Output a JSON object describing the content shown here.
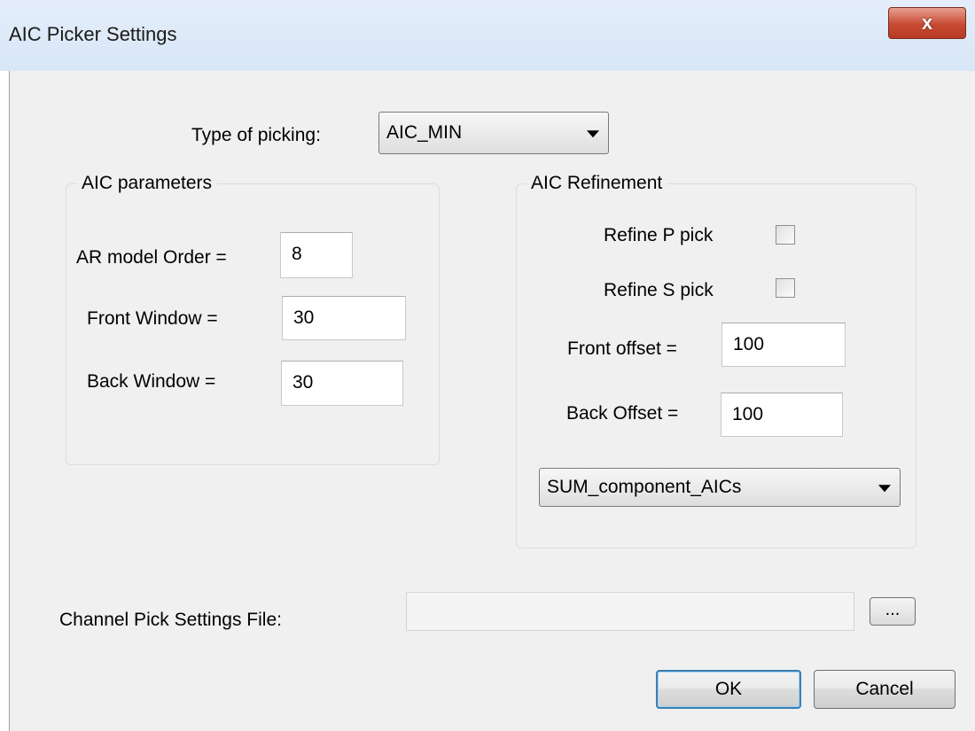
{
  "window": {
    "title": "AIC Picker Settings",
    "close_glyph": "x"
  },
  "picking": {
    "label": "Type of picking:",
    "selected": "AIC_MIN"
  },
  "aic_parameters": {
    "title": "AIC parameters",
    "ar_order_label": "AR model Order =",
    "ar_order_value": "8",
    "front_window_label": "Front Window =",
    "front_window_value": "30",
    "back_window_label": "Back Window =",
    "back_window_value": "30"
  },
  "aic_refinement": {
    "title": "AIC Refinement",
    "refine_p_label": "Refine P pick",
    "refine_p_checked": false,
    "refine_s_label": "Refine S pick",
    "refine_s_checked": false,
    "front_offset_label": "Front offset =",
    "front_offset_value": "100",
    "back_offset_label": "Back Offset =",
    "back_offset_value": "100",
    "method_selected": "SUM_component_AICs"
  },
  "channel_file": {
    "label": "Channel Pick Settings File:",
    "value": "",
    "browse_label": "..."
  },
  "buttons": {
    "ok": "OK",
    "cancel": "Cancel"
  }
}
